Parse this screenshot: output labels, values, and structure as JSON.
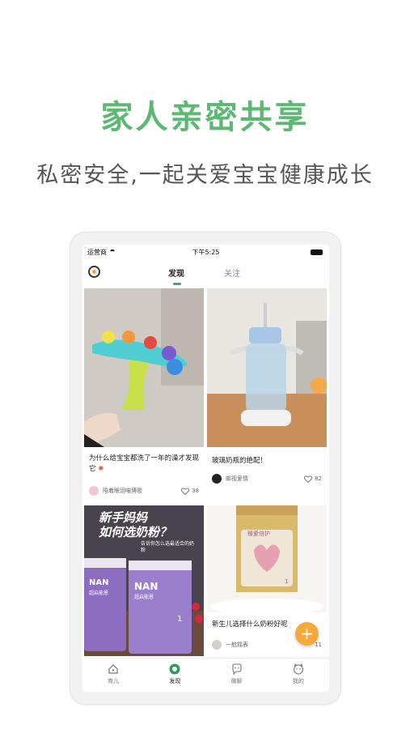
{
  "hero": {
    "title": "家人亲密共享",
    "subtitle": "私密安全,一起关爱宝宝健康成长"
  },
  "status_bar": {
    "carrier": "运营商",
    "time": "下午5:25"
  },
  "top_tabs": [
    {
      "label": "发现",
      "active": true
    },
    {
      "label": "关注",
      "active": false
    }
  ],
  "feed": [
    {
      "title": "为什么给宝宝都洗了一年的澡才发现它",
      "author": "陪着眼泪喵博歌",
      "likes": "38"
    },
    {
      "title": "玻璃奶瓶的绝配！",
      "author": "邮视爱情",
      "likes": "82"
    },
    {
      "image_text": [
        "新手妈妈",
        "如何选奶粉？"
      ],
      "caption": "告诉你怎么选最适合的奶粉",
      "product": "NAN",
      "product_sub": "超启能恩",
      "stage": "1"
    },
    {
      "title": "新生儿选择什么奶粉好呢",
      "author": "一舱摇表",
      "likes": "11",
      "product": "臻爱倍护",
      "stage": "1"
    }
  ],
  "fab": {
    "label": "+"
  },
  "bottom_tabs": [
    {
      "label": "育儿",
      "icon": "home-icon"
    },
    {
      "label": "发现",
      "icon": "discover-icon",
      "active": true
    },
    {
      "label": "微聊",
      "icon": "chat-icon"
    },
    {
      "label": "我的",
      "icon": "profile-icon"
    }
  ],
  "colors": {
    "brand_green": "#5cb872",
    "tab_indicator": "#3caa6a",
    "fab": "#f5a93a"
  }
}
